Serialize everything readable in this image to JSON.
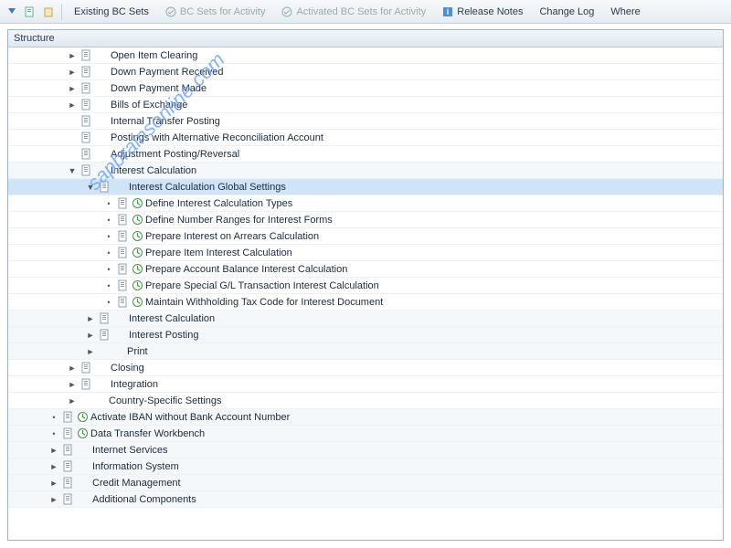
{
  "toolbar": {
    "existing_bc": "Existing BC Sets",
    "bc_activity": "BC Sets for Activity",
    "activated_bc": "Activated BC Sets for Activity",
    "release_notes": "Release Notes",
    "change_log": "Change Log",
    "where": "Where"
  },
  "tree_header": "Structure",
  "watermark": "sapbrainsonline.com",
  "rows": [
    {
      "indent": 3,
      "exp": "►",
      "doc": true,
      "label": "Open Item Clearing"
    },
    {
      "indent": 3,
      "exp": "►",
      "doc": true,
      "label": "Down Payment Received"
    },
    {
      "indent": 3,
      "exp": "►",
      "doc": true,
      "label": "Down Payment Made"
    },
    {
      "indent": 3,
      "exp": "►",
      "doc": true,
      "label": "Bills of Exchange"
    },
    {
      "indent": 3,
      "exp": "",
      "doc": true,
      "label": "Internal Transfer Posting"
    },
    {
      "indent": 3,
      "exp": "",
      "doc": true,
      "label": "Postings with Alternative Reconciliation Account"
    },
    {
      "indent": 3,
      "exp": "",
      "doc": true,
      "label": "Adjustment Posting/Reversal"
    },
    {
      "indent": 3,
      "exp": "▼",
      "doc": true,
      "label": "Interest Calculation",
      "zebra": true
    },
    {
      "indent": 4,
      "exp": "▼",
      "doc": true,
      "label": "Interest Calculation Global Settings",
      "selected": true
    },
    {
      "indent": 5,
      "exp": "•",
      "doc": true,
      "clock": true,
      "label": "Define Interest Calculation Types"
    },
    {
      "indent": 5,
      "exp": "•",
      "doc": true,
      "clock": true,
      "label": "Define Number Ranges for Interest Forms"
    },
    {
      "indent": 5,
      "exp": "•",
      "doc": true,
      "clock": true,
      "label": "Prepare Interest on Arrears Calculation"
    },
    {
      "indent": 5,
      "exp": "•",
      "doc": true,
      "clock": true,
      "label": "Prepare Item Interest Calculation"
    },
    {
      "indent": 5,
      "exp": "•",
      "doc": true,
      "clock": true,
      "label": "Prepare Account Balance Interest Calculation"
    },
    {
      "indent": 5,
      "exp": "•",
      "doc": true,
      "clock": true,
      "label": "Prepare Special G/L Transaction Interest Calculation"
    },
    {
      "indent": 5,
      "exp": "•",
      "doc": true,
      "clock": true,
      "label": "Maintain Withholding Tax Code for Interest Document"
    },
    {
      "indent": 4,
      "exp": "►",
      "doc": true,
      "label": "Interest Calculation",
      "zebra": true
    },
    {
      "indent": 4,
      "exp": "►",
      "doc": true,
      "label": "Interest Posting",
      "zebra": true
    },
    {
      "indent": 4,
      "exp": "►",
      "doc": false,
      "label": "Print",
      "zebra": true
    },
    {
      "indent": 3,
      "exp": "►",
      "doc": true,
      "label": "Closing"
    },
    {
      "indent": 3,
      "exp": "►",
      "doc": true,
      "label": "Integration"
    },
    {
      "indent": 3,
      "exp": "►",
      "doc": false,
      "label": "Country-Specific Settings"
    },
    {
      "indent": 2,
      "exp": "•",
      "doc": true,
      "clock": true,
      "label": "Activate IBAN without Bank Account Number",
      "zebra": true
    },
    {
      "indent": 2,
      "exp": "•",
      "doc": true,
      "clock": true,
      "label": "Data Transfer Workbench",
      "zebra": true
    },
    {
      "indent": 2,
      "exp": "►",
      "doc": true,
      "label": "Internet Services",
      "zebra": true
    },
    {
      "indent": 2,
      "exp": "►",
      "doc": true,
      "label": "Information System",
      "zebra": true
    },
    {
      "indent": 2,
      "exp": "►",
      "doc": true,
      "label": "Credit Management",
      "zebra": true
    },
    {
      "indent": 2,
      "exp": "►",
      "doc": true,
      "label": "Additional Components",
      "zebra": true
    }
  ]
}
